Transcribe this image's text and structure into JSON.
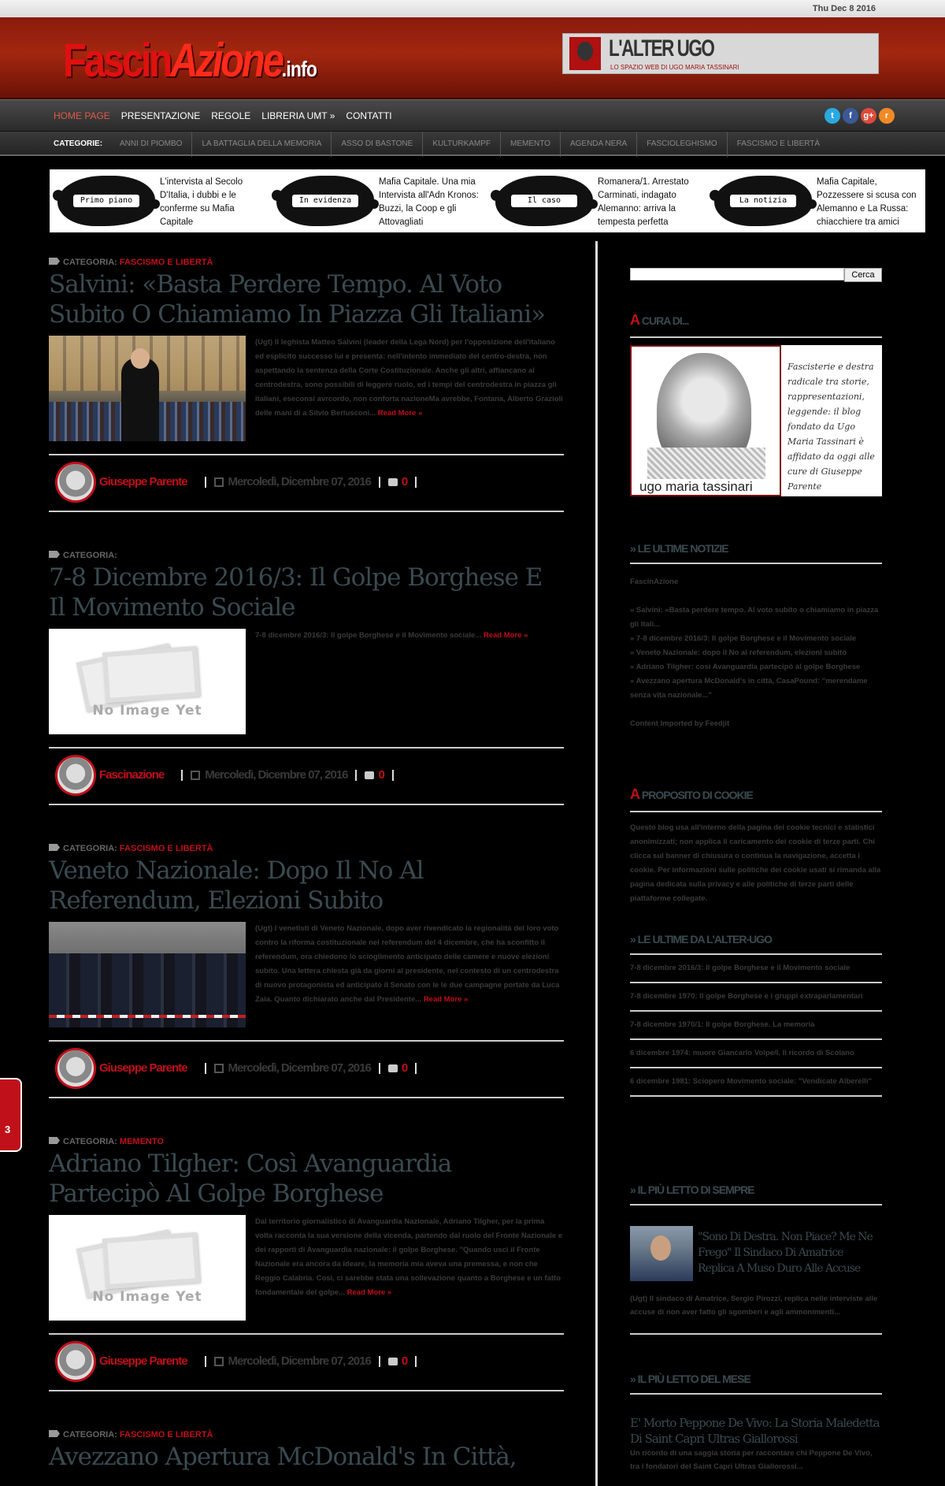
{
  "date": "Thu Dec 8 2016",
  "logo": {
    "part1": "Fascin",
    "part2": "Azione",
    "suffix": ".info"
  },
  "banner": {
    "title": "L'ALTER UGO",
    "subtitle": "LO SPAZIO WEB DI UGO MARIA TASSINARI"
  },
  "nav": {
    "items": [
      "HOME PAGE",
      "PRESENTAZIONE",
      "REGOLE",
      "LIBRERIA UMT »",
      "CONTATTI"
    ],
    "social": [
      "twitter-icon",
      "facebook-icon",
      "google-plus-icon",
      "rss-icon"
    ],
    "social_glyphs": [
      "t",
      "f",
      "g+",
      "r"
    ]
  },
  "categories": {
    "label": "CATEGORIE:",
    "items": [
      "ANNI DI PIOMBO",
      "LA BATTAGLIA DELLA MEMORIA",
      "ASSO DI BASTONE",
      "KULTURKAMPF",
      "MEMENTO",
      "AGENDA NERA",
      "FASCIOLEGHISMO",
      "FASCISMO E LIBERTÀ"
    ]
  },
  "featured": [
    {
      "badge": "Primo piano",
      "text": "L'intervista al Secolo D'Italia, i dubbi e le conferme su Mafia Capitale"
    },
    {
      "badge": "In evidenza",
      "text": "Mafia Capitale. Una mia Intervista all'Adn Kronos: Buzzi, la Coop e gli Attovagliati"
    },
    {
      "badge": "Il caso",
      "text": "Romanera/1. Arrestato Carminati, indagato Alemanno: arriva la tempesta perfetta"
    },
    {
      "badge": "La notizia",
      "text": "Mafia Capitale, Pozzessere si scusa con Alemanno e La Russa: chiacchiere tra amici"
    }
  ],
  "posts": [
    {
      "cat_label": "CATEGORIA:",
      "cat_value": "FASCISMO E LIBERTÀ",
      "title": "Salvini: «Basta Perdere Tempo. Al Voto Subito O Chiamiamo In Piazza Gli Italiani»",
      "excerpt": "(Ugt) Il leghista Matteo Salvini (leader della Lega Nord) per l'opposizione dell'italiano ed esplicito successo lui e presenta: nell'intento immediato del centro-destra, non aspettando la sentenza della Corte Costituzionale. Anche gli altri, affiancano al centrodestra, sono possibili di leggere ruolo, ed i tempi del centrodestra in piazza gli italiani, eseconsi avrcordo, non conforta nazioneMa avrebbe, Fontana, Alberto Grazioli delle mani di a Silvio Berlusconi...",
      "more": "Read More »",
      "author": "Giuseppe Parente",
      "date": "Mercoledì, Dicembre 07, 2016",
      "comments": "0",
      "thumb": "salvini"
    },
    {
      "cat_label": "CATEGORIA:",
      "cat_value": "",
      "title": "7-8 Dicembre 2016/3: Il Golpe Borghese E Il Movimento Sociale",
      "excerpt": "7-8 dicembre 2016/3: Il golpe Borghese e il Movimento sociale...",
      "more": "Read More »",
      "author": "Fascinazione",
      "date": "Mercoledì, Dicembre 07, 2016",
      "comments": "0",
      "thumb": "noimg"
    },
    {
      "cat_label": "CATEGORIA:",
      "cat_value": "FASCISMO E LIBERTÀ",
      "title": "Veneto Nazionale: Dopo Il No Al Referendum, Elezioni Subito",
      "excerpt": "(Ugt) I venetisti di Veneto Nazionale, dopo aver rivendicato la regionalità del loro voto contro la riforma costituzionale nel referendum del 4 dicembre, che ha sconfitto il referendum, ora chiedono lo scioglimento anticipato delle camere e nuove elezioni subito. Una lettera chiesta già da giorni al presidente, nel contesto di un centrodestra di nuovo protagonista ed anticipato il Senato con le le due campagne portate da Luca Zaia. Quanto dichiarato anche dal Presidente...",
      "more": "Read More »",
      "author": "Giuseppe Parente",
      "date": "Mercoledì, Dicembre 07, 2016",
      "comments": "0",
      "thumb": "veneto"
    },
    {
      "cat_label": "CATEGORIA:",
      "cat_value": "MEMENTO",
      "title": "Adriano Tilgher: Così Avanguardia Partecipò Al Golpe Borghese",
      "excerpt": "Dal territorio giornalistico di Avanguardia Nazionale, Adriano Tilgher, per la prima volta racconta la sua versione della vicenda, partendo dal ruolo del Fronte Nazionale e dei rapporti di Avanguardia nazionale: il golpe Borghese. \"Quando uscì il Fronte Nazionale era ancora da ideare, la memoria mia aveva una premessa, e non che Reggio Calabria. Così, ci sarebbe stata una sollevazione quanto a Borghese e un fatto fondamentale del golpe...",
      "more": "Read More »",
      "author": "Giuseppe Parente",
      "date": "Mercoledì, Dicembre 07, 2016",
      "comments": "0",
      "thumb": "noimg"
    },
    {
      "cat_label": "CATEGORIA:",
      "cat_value": "FASCISMO E LIBERTÀ",
      "title": "Avezzano Apertura McDonald's In Città,",
      "excerpt": "",
      "more": "",
      "author": "",
      "date": "",
      "comments": "",
      "thumb": "none"
    }
  ],
  "no_image_caption": "No Image Yet",
  "sidebar": {
    "search_button": "Cerca",
    "cura_title": "A CURA DI...",
    "cura_name": "ugo maria tassinari",
    "cura_text": "Fascisterie e destra radicale tra storie, rappresentazioni, leggende: il blog fondato da Ugo Maria Tassinari è affidato da oggi alle cure di Giuseppe Parente",
    "news_title": "» LE ULTIME NOTIZIE",
    "news_source": "FascinAzione",
    "news_items": [
      "» Salvini: «Basta perdere tempo. Al voto subito o chiamiamo in piazza gli Itali...",
      "» 7-8 dicembre 2016/3: Il golpe Borghese e il Movimento sociale",
      "» Veneto Nazionale: dopo il No al referendum, elezioni subito",
      "» Adriano Tilgher: così Avanguardia partecipò al golpe Borghese",
      "» Avezzano apertura McDonald's in città, CasaPound: \"merendame senza vita nazionale...\""
    ],
    "news_credit": "Content Imported by Feedjit",
    "cookie_title": "A PROPOSITO DI COOKIE",
    "cookie_text": "Questo blog usa all'interno della pagina dei cookie tecnici e statistici anonimizzati; non applica il caricamento dei cookie di terze parti. Chi clicca sul banner di chiusura o continua la navigazione, accetta i cookie. Per informazioni sulle politiche dei cookie usati si rimanda alla pagina dedicata sulla privacy e alle politiche di terze parti delle piattaforme collegate.",
    "alterugo_title": "» LE ULTIME DA L'ALTER-UGO",
    "alterugo_items": [
      "7-8 dicembre 2016/3: Il golpe Borghese e il Movimento sociale",
      "7-8 dicembre 1970: Il golpe Borghese e i gruppi extraparlamentari",
      "7-8 dicembre 1970/1: Il golpe Borghese. La memoria",
      "6 dicembre 1974: muore Giancarlo Volpe/I. Il ricordo di Scoiano",
      "6 dicembre 1981: Sciopero Movimento sociale: \"Vendicate Alberelli\""
    ],
    "always_title": "» IL PIÙ LETTO DI SEMPRE",
    "always_post_title": "\"Sono Di Destra. Non Piace? Me Ne Frego\" Il Sindaco Di Amatrice Replica A Muso Duro Alle Accuse",
    "always_post_excerpt": "(Ugt) Il sindaco di Amatrice, Sergio Pirozzi, replica nelle interviste alle accuse di non aver fatto gli sgomberi e agli ammonimenti...",
    "month_title": "» IL PIÙ LETTO DEL MESE",
    "month_post_title": "E' Morto Peppone De Vivo: La Storia Maledetta Di Saint Capri Ultras Giallorossi",
    "month_post_excerpt": "Un ricordo di una saggia storia per raccontare chi Peppone De Vivo, tra i fondatori del Saint Capri Ultras Giallorossi..."
  },
  "side_tab": "3"
}
